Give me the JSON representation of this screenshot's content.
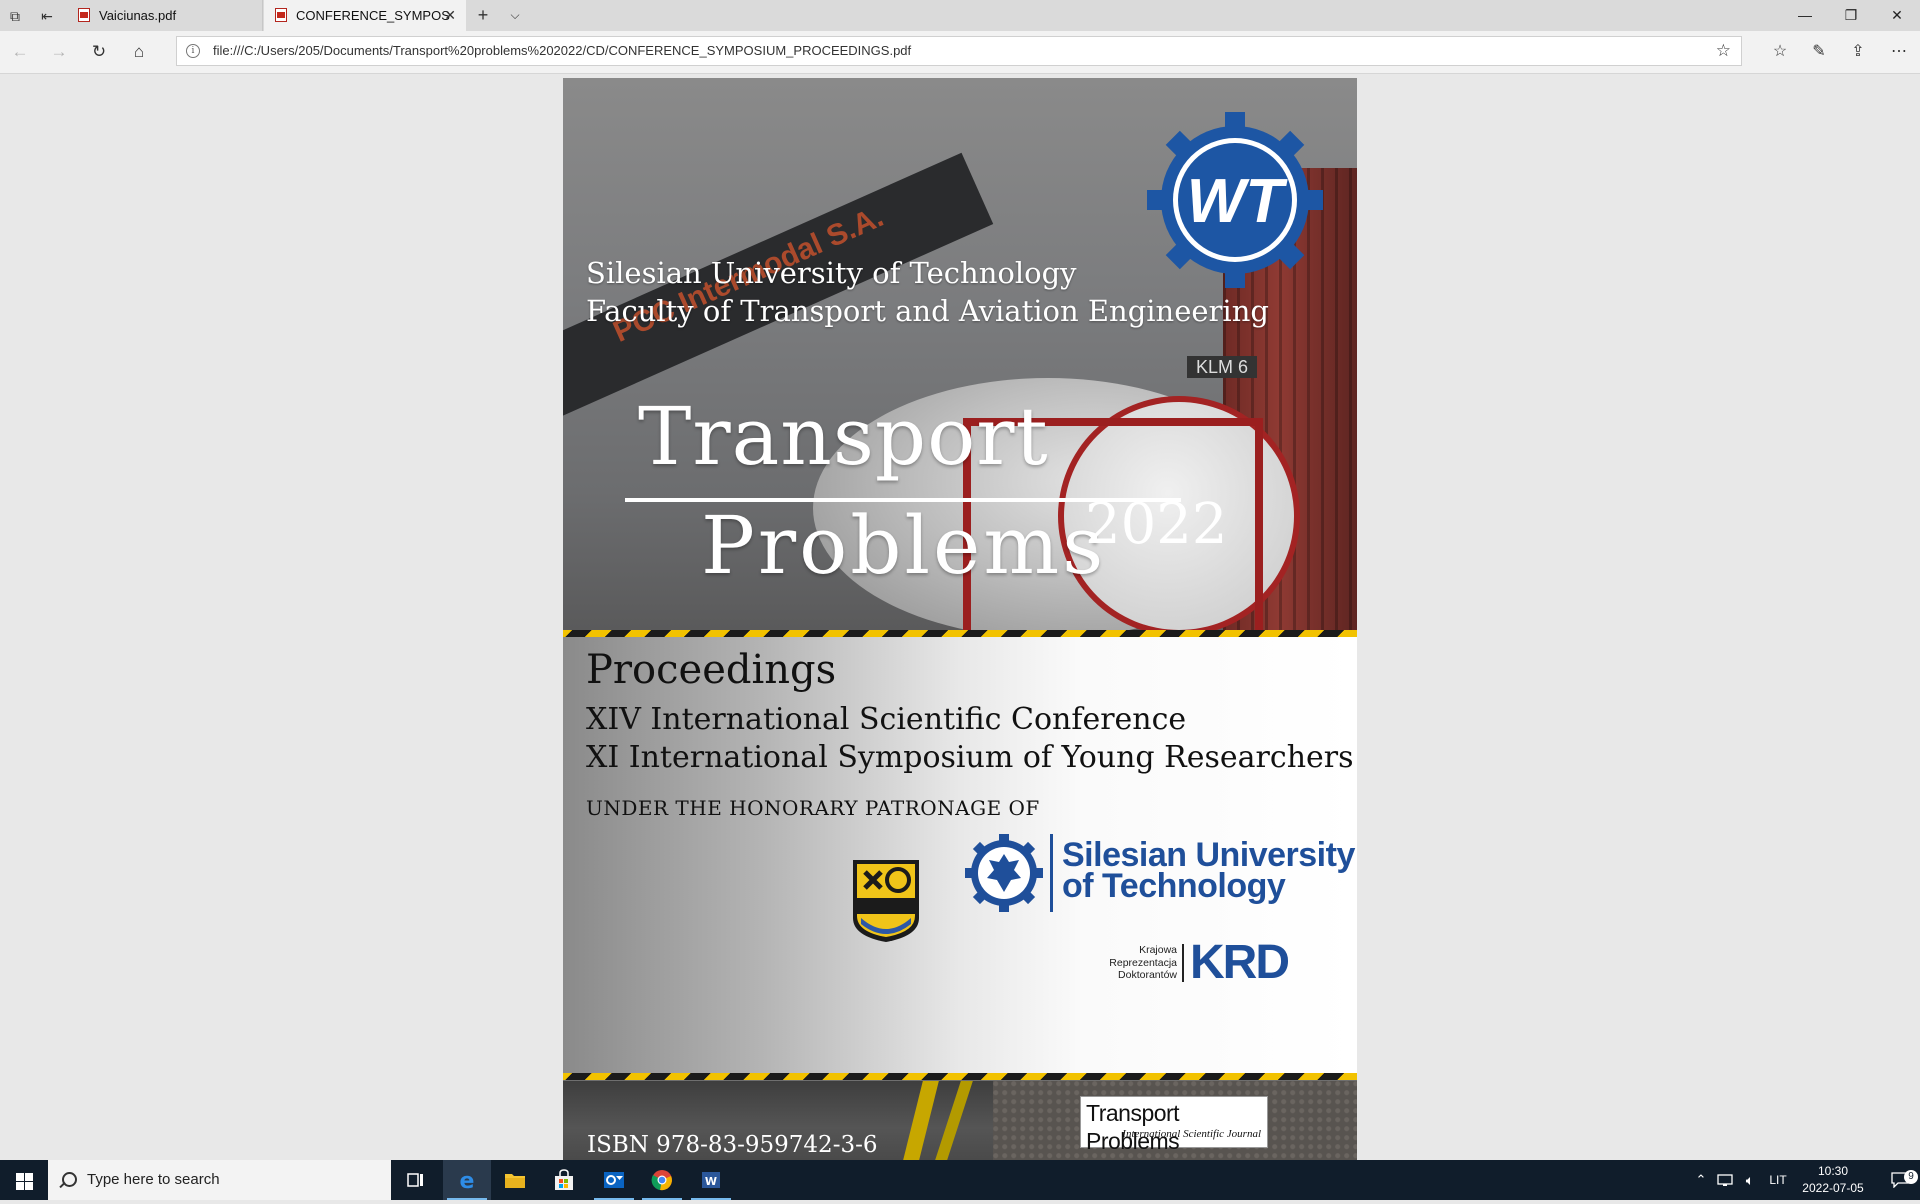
{
  "browser": {
    "tabs": [
      {
        "label": "Vaiciunas.pdf",
        "active": false
      },
      {
        "label": "CONFERENCE_SYMPOS",
        "active": true
      }
    ],
    "address": "file:///C:/Users/205/Documents/Transport%20problems%202022/CD/CONFERENCE_SYMPOSIUM_PROCEEDINGS.pdf"
  },
  "cover": {
    "university": "Silesian University of Technology",
    "faculty": "Faculty of Transport and Aviation Engineering",
    "title_word1": "Transport",
    "title_word2": "Problems",
    "year": "2022",
    "proceedings": "Proceedings",
    "conference": "XIV International Scientific Conference",
    "symposium": "XI International Symposium of Young Researchers",
    "patronage": "UNDER THE HONORARY PATRONAGE OF",
    "sut_logo_line1": "Silesian University",
    "sut_logo_line2": "of Technology",
    "krd_small_1": "Krajowa",
    "krd_small_2": "Reprezentacja",
    "krd_small_3": "Doktorantów",
    "krd": "KRD",
    "photo_arm_text": "PCC Intermodal S.A.",
    "photo_klm": "KLM 6",
    "wt_logo": "WT",
    "journal_name": "Transport Problems",
    "journal_sub": "International Scientific Journal",
    "isbn": "ISBN 978-83-959742-3-6"
  },
  "taskbar": {
    "search_placeholder": "Type here to search",
    "language": "LIT",
    "time": "10:30",
    "date": "2022-07-05",
    "notification_count": "9"
  },
  "colors": {
    "brand_blue": "#1f4f9a",
    "hazard_yellow": "#f2c200",
    "taskbar": "#101d2b"
  }
}
